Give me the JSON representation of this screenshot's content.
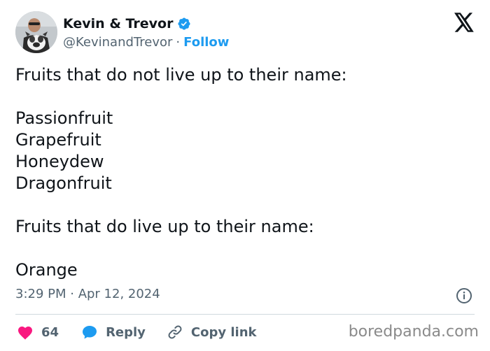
{
  "author": {
    "display_name": "Kevin & Trevor",
    "handle": "@KevinandTrevor",
    "separator": "·",
    "follow_label": "Follow"
  },
  "tweet": {
    "lines": [
      "Fruits that do not live up to their name:",
      "",
      "Passionfruit",
      "Grapefruit",
      "Honeydew",
      "Dragonfruit",
      "",
      "Fruits that do live up to their name:",
      "",
      "Orange"
    ],
    "timestamp": "3:29 PM · Apr 12, 2024"
  },
  "actions": {
    "like_count": "64",
    "reply_label": "Reply",
    "copy_link_label": "Copy link"
  },
  "watermark": "boredpanda.com",
  "icons": {
    "verified": "verified-badge-icon",
    "logo": "x-logo-icon",
    "info": "info-icon",
    "like": "heart-icon",
    "reply": "speech-bubble-icon",
    "copy_link": "link-icon"
  },
  "colors": {
    "accent": "#1d9bf0",
    "like": "#f91880",
    "text": "#0f1419",
    "secondary": "#536471"
  }
}
